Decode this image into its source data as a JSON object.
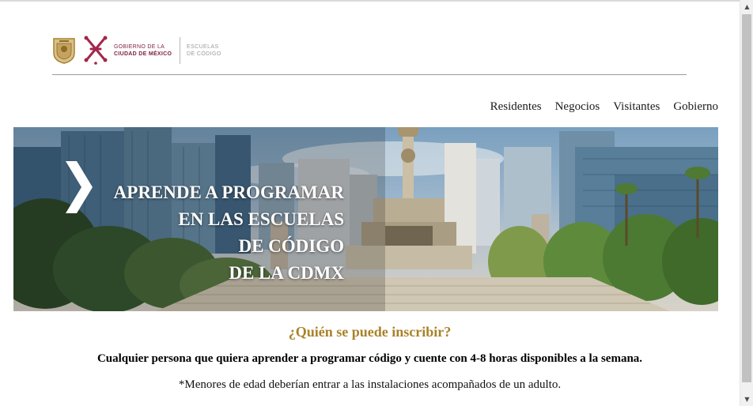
{
  "header": {
    "logo_line_1": "GOBIERNO DE LA",
    "logo_line_2": "CIUDAD DE MÉXICO",
    "logo_line_3": "ESCUELAS",
    "logo_line_4": "DE CÓDIGO",
    "brand_color": "#7d1d3f",
    "gold_color": "#a9822a"
  },
  "nav": {
    "items": [
      {
        "label": "Residentes"
      },
      {
        "label": "Negocios"
      },
      {
        "label": "Visitantes"
      },
      {
        "label": "Gobierno"
      }
    ]
  },
  "hero": {
    "lines": [
      "APRENDE A PROGRAMAR",
      "EN LAS ESCUELAS",
      "DE CÓDIGO",
      "DE LA CDMX"
    ],
    "icon": "chevron-right-icon"
  },
  "content": {
    "question": "¿Quién se puede inscribir?",
    "answer": "Cualquier persona que quiera aprender a programar código y cuente con 4-8 horas disponibles a la semana.",
    "note": "*Menores de edad deberían entrar a las instalaciones acompañados de un adulto."
  }
}
